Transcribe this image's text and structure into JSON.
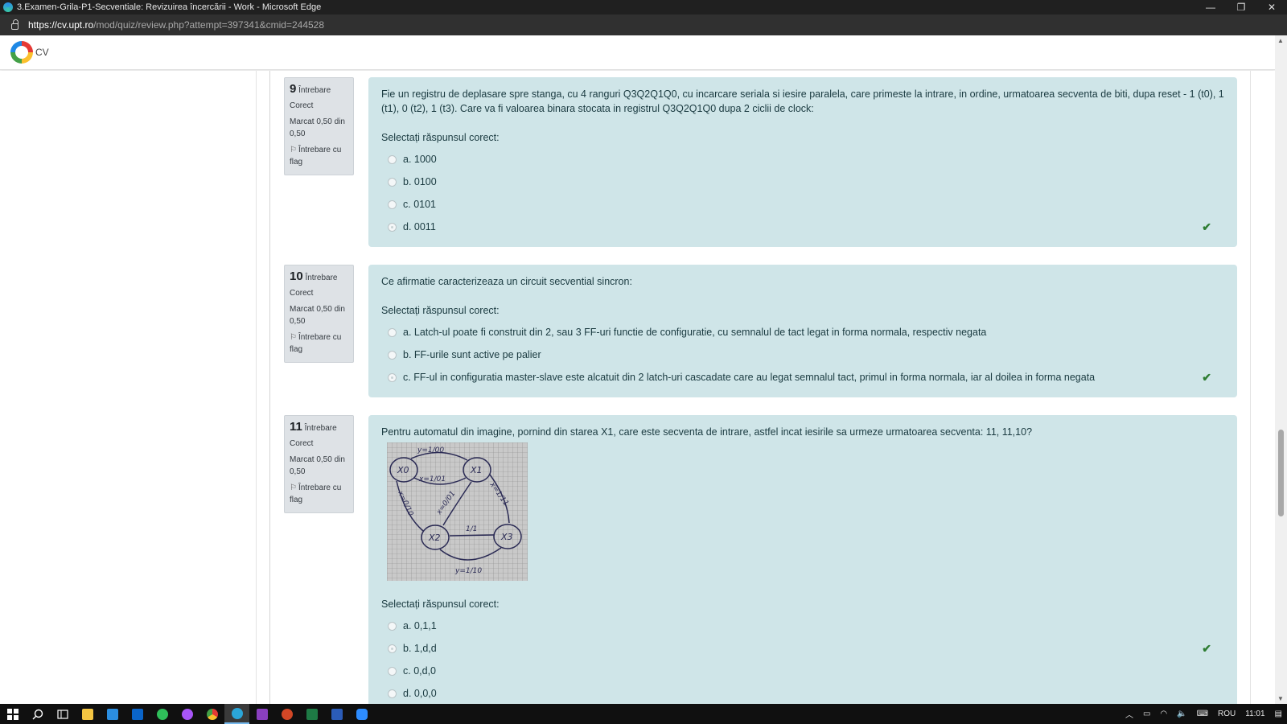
{
  "window": {
    "title": "3.Examen-Grila-P1-Secventiale: Revizuirea încercării - Work - Microsoft Edge",
    "minimize": "—",
    "restore": "❐",
    "close": "✕"
  },
  "address": {
    "host": "https://cv.upt.ro",
    "path": "/mod/quiz/review.php?attempt=397341&cmid=244528"
  },
  "site": {
    "logo_text": "CV"
  },
  "questions": [
    {
      "number": "9",
      "label": "Întrebare",
      "state": "Corect",
      "grade": "Marcat 0,50 din 0,50",
      "flag": "Întrebare cu flag",
      "text": "Fie un registru de deplasare spre stanga, cu 4 ranguri Q3Q2Q1Q0, cu incarcare seriala si iesire paralela, care primeste la intrare, in ordine, urmatoarea secventa de biti, dupa reset - 1 (t0), 1 (t1), 0 (t2), 1 (t3). Care va fi valoarea binara stocata in registrul Q3Q2Q1Q0 dupa 2 ciclii de clock:",
      "prompt": "Selectați răspunsul corect:",
      "answers": [
        "a. 1000",
        "b. 0100",
        "c. 0101",
        "d. 0011"
      ],
      "selected": 3
    },
    {
      "number": "10",
      "label": "Întrebare",
      "state": "Corect",
      "grade": "Marcat 0,50 din 0,50",
      "flag": "Întrebare cu flag",
      "text": "Ce afirmatie caracterizeaza un circuit secvential sincron:",
      "prompt": "Selectați răspunsul corect:",
      "answers": [
        "a. Latch-ul poate fi construit din 2, sau 3 FF-uri functie de configuratie, cu semnalul de tact legat in forma normala, respectiv negata",
        "b. FF-urile sunt active pe palier",
        "c. FF-ul in configuratia master-slave este alcatuit din 2 latch-uri cascadate care au legat semnalul tact, primul in forma normala, iar al doilea in forma negata"
      ],
      "selected": 2
    },
    {
      "number": "11",
      "label": "Întrebare",
      "state": "Corect",
      "grade": "Marcat 0,50 din 0,50",
      "flag": "Întrebare cu flag",
      "text": "Pentru automatul din imagine, pornind din starea X1, care este secventa de intrare, astfel incat iesirile sa urmeze urmatoarea secventa: 11, 11,10?",
      "prompt": "Selectați răspunsul corect:",
      "answers": [
        "a. 0,1,1",
        "b. 1,d,d",
        "c. 0,d,0",
        "d. 0,0,0"
      ],
      "selected": 1,
      "diagram": {
        "states": [
          "X0",
          "X1",
          "X2",
          "X3"
        ],
        "labels": [
          "y=1/00",
          "x=1/01",
          "x=0/01",
          "x=1/11",
          "x=0/10",
          "1/1",
          "y=1/10"
        ]
      }
    }
  ],
  "taskbar": {
    "language": "ROU",
    "time": "11:01"
  },
  "icons": {
    "checkmark": "✔",
    "flag": "⚐"
  }
}
